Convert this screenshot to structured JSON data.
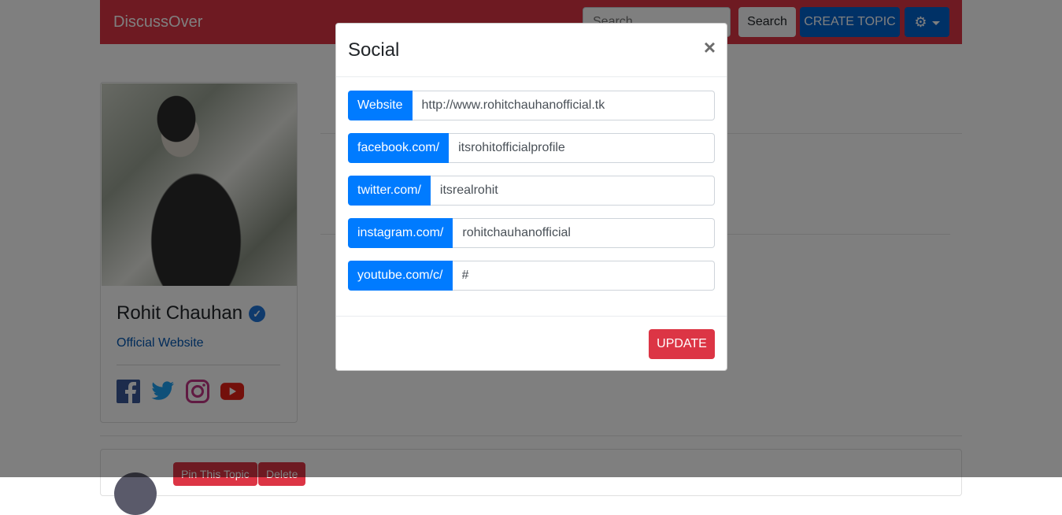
{
  "navbar": {
    "brand": "DiscussOver",
    "search_placeholder": "Search",
    "search_button": "Search",
    "create_button": "CREATE TOPIC"
  },
  "profile": {
    "name": "Rohit Chauhan",
    "website_link": "Official Website",
    "social_icons": [
      "facebook-icon",
      "twitter-icon",
      "instagram-icon",
      "youtube-icon"
    ]
  },
  "topic_actions": {
    "pin": "Pin This Topic",
    "delete": "Delete"
  },
  "modal": {
    "title": "Social",
    "close": "×",
    "fields": [
      {
        "prefix": "Website",
        "value": "http://www.rohitchauhanofficial.tk"
      },
      {
        "prefix": "facebook.com/",
        "value": "itsrohitofficialprofile"
      },
      {
        "prefix": "twitter.com/",
        "value": "itsrealrohit"
      },
      {
        "prefix": "instagram.com/",
        "value": "rohitchauhanofficial"
      },
      {
        "prefix": "youtube.com/c/",
        "value": "#"
      }
    ],
    "update_button": "UPDATE"
  },
  "colors": {
    "navbar": "#dc3545",
    "primary": "#007bff",
    "danger": "#dc3545"
  }
}
